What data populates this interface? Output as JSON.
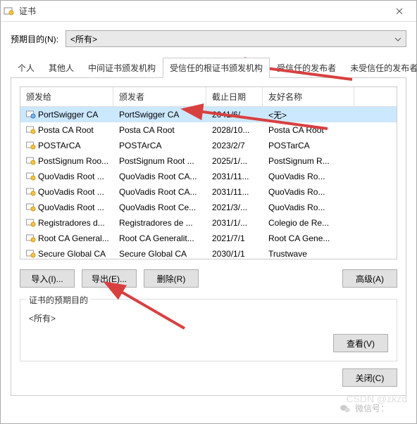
{
  "window": {
    "title": "证书"
  },
  "purpose": {
    "label": "预期目的(N):",
    "value": "<所有>"
  },
  "tabs": [
    "个人",
    "其他人",
    "中间证书颁发机构",
    "受信任的根证书颁发机构",
    "受信任的发布者",
    "未受信任的发布者"
  ],
  "active_tab": 3,
  "columns": [
    "颁发给",
    "颁发者",
    "截止日期",
    "友好名称"
  ],
  "rows": [
    {
      "issued_to": "PortSwigger CA",
      "issuer": "PortSwigger CA",
      "expiry": "2041/6/...",
      "friendly": "<无>",
      "selected": true,
      "ico": "blue"
    },
    {
      "issued_to": "Posta CA Root",
      "issuer": "Posta CA Root",
      "expiry": "2028/10...",
      "friendly": "Posta CA Root",
      "ico": "gold"
    },
    {
      "issued_to": "POSTArCA",
      "issuer": "POSTArCA",
      "expiry": "2023/2/7",
      "friendly": "POSTarCA",
      "ico": "gold"
    },
    {
      "issued_to": "PostSignum Roo...",
      "issuer": "PostSignum Root ...",
      "expiry": "2025/1/...",
      "friendly": "PostSignum R...",
      "ico": "gold"
    },
    {
      "issued_to": "QuoVadis Root ...",
      "issuer": "QuoVadis Root CA...",
      "expiry": "2031/11...",
      "friendly": "QuoVadis Ro...",
      "ico": "gold"
    },
    {
      "issued_to": "QuoVadis Root ...",
      "issuer": "QuoVadis Root CA...",
      "expiry": "2031/11...",
      "friendly": "QuoVadis Ro...",
      "ico": "gold"
    },
    {
      "issued_to": "QuoVadis Root ...",
      "issuer": "QuoVadis Root Ce...",
      "expiry": "2021/3/...",
      "friendly": "QuoVadis Ro...",
      "ico": "gold"
    },
    {
      "issued_to": "Registradores d...",
      "issuer": "Registradores de ...",
      "expiry": "2031/1/...",
      "friendly": "Colegio de Re...",
      "ico": "gold"
    },
    {
      "issued_to": "Root CA General...",
      "issuer": "Root CA Generalit...",
      "expiry": "2021/7/1",
      "friendly": "Root CA Gene...",
      "ico": "gold"
    },
    {
      "issued_to": "Secure Global CA",
      "issuer": "Secure Global CA",
      "expiry": "2030/1/1",
      "friendly": "Trustwave",
      "ico": "gold"
    }
  ],
  "buttons": {
    "import": "导入(I)...",
    "export": "导出(E)...",
    "remove": "删除(R)",
    "advanced": "高级(A)",
    "view": "查看(V)",
    "close": "关闭(C)"
  },
  "fieldset": {
    "legend": "证书的预期目的",
    "text": "<所有>"
  },
  "watermark": {
    "wx": "微信号：",
    "csdn": "CSDN @zkzd"
  },
  "arrow_color": "#d84040"
}
